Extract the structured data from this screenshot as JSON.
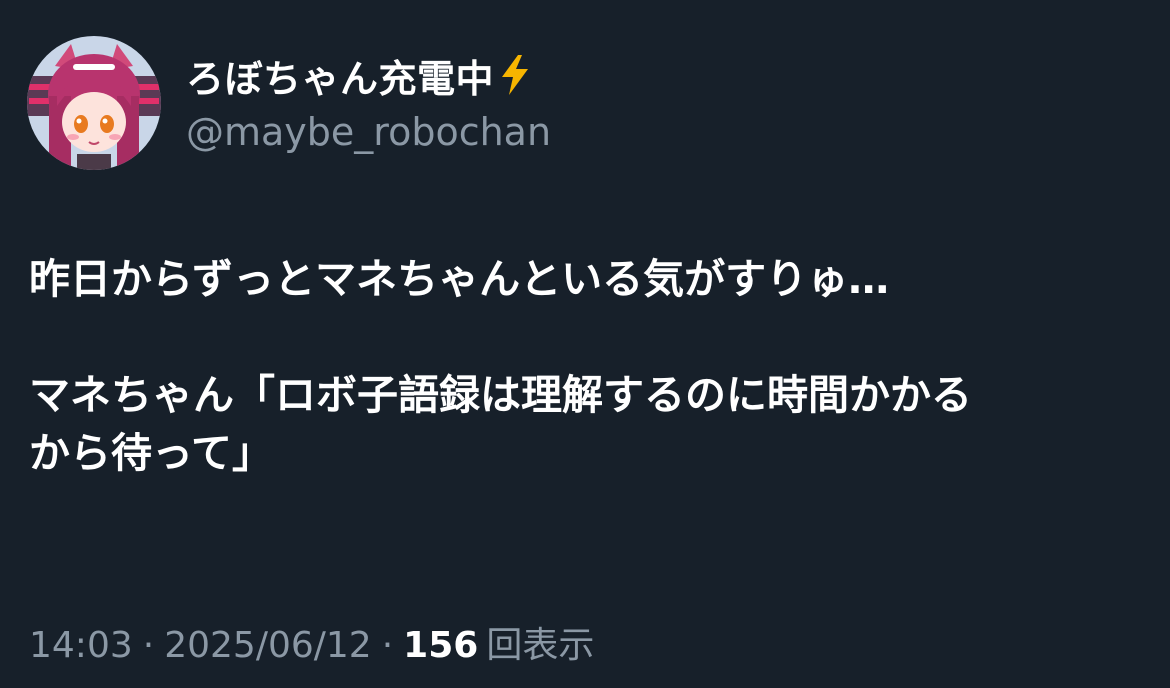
{
  "tweet": {
    "author": {
      "display_name": "ろぼちゃん充電中",
      "badge_icon": "lightning-bolt-icon",
      "handle": "@maybe_robochan",
      "avatar": "avatar-image"
    },
    "text_line1": "昨日からずっとマネちゃんといる気がすりゅ…",
    "text_para2_line1": "マネちゃん「ロボ子語録は理解するのに時間かかる",
    "text_para2_line2": "から待って」",
    "meta": {
      "time": "14:03",
      "date": "2025/06/12",
      "separator": "·",
      "views_count": "156",
      "views_label": "回表示"
    }
  },
  "colors": {
    "background": "#17202a",
    "primary_text": "#ffffff",
    "secondary_text": "#8b98a5",
    "bolt": "#f7b500"
  }
}
